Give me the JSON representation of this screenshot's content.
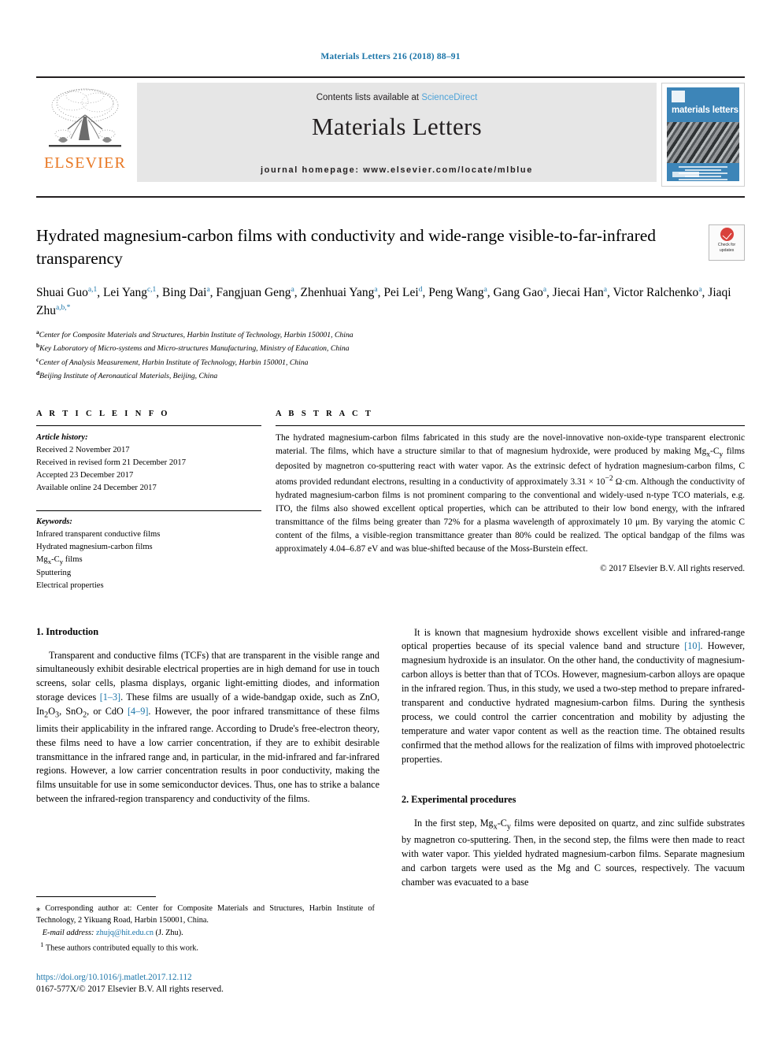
{
  "running_head": "Materials Letters 216 (2018) 88–91",
  "masthead": {
    "publisher": "ELSEVIER",
    "contents_prefix": "Contents lists available at ",
    "contents_link": "ScienceDirect",
    "journal_title": "Materials Letters",
    "homepage": "journal homepage: www.elsevier.com/locate/mlblue",
    "cover_label": "materials letters"
  },
  "title": "Hydrated magnesium-carbon films with conductivity and wide-range visible-to-far-infrared transparency",
  "crossmark": {
    "line1": "Check for",
    "line2": "updates"
  },
  "authors": [
    {
      "name": "Shuai Guo",
      "sup": "a,1",
      "sep": ", "
    },
    {
      "name": "Lei Yang",
      "sup": "c,1",
      "sep": ", "
    },
    {
      "name": "Bing Dai",
      "sup": "a",
      "sep": ", "
    },
    {
      "name": "Fangjuan Geng",
      "sup": "a",
      "sep": ", "
    },
    {
      "name": "Zhenhuai Yang",
      "sup": "a",
      "sep": ", "
    },
    {
      "name": "Pei Lei",
      "sup": "d",
      "sep": ", "
    },
    {
      "name": "Peng Wang",
      "sup": "a",
      "sep": ", "
    },
    {
      "name": "Gang Gao",
      "sup": "a",
      "sep": ", "
    },
    {
      "name": "Jiecai Han",
      "sup": "a",
      "sep": ", "
    },
    {
      "name": "Victor Ralchenko",
      "sup": "a",
      "sep": ", "
    },
    {
      "name": "Jiaqi Zhu",
      "sup": "a,b,*",
      "sep": ""
    }
  ],
  "affiliations": [
    {
      "mark": "a",
      "text": "Center for Composite Materials and Structures, Harbin Institute of Technology, Harbin 150001, China"
    },
    {
      "mark": "b",
      "text": "Key Laboratory of Micro-systems and Micro-structures Manufacturing, Ministry of Education, China"
    },
    {
      "mark": "c",
      "text": "Center of Analysis Measurement, Harbin Institute of Technology, Harbin 150001, China"
    },
    {
      "mark": "d",
      "text": "Beijing Institute of Aeronautical Materials, Beijing, China"
    }
  ],
  "article_info": {
    "heading": "A R T I C L E   I N F O",
    "history_label": "Article history:",
    "history": [
      "Received 2 November 2017",
      "Received in revised form 21 December 2017",
      "Accepted 23 December 2017",
      "Available online 24 December 2017"
    ],
    "keywords_label": "Keywords:",
    "keywords": [
      "Infrared transparent conductive films",
      "Hydrated magnesium-carbon films",
      "Mgx-Cy films",
      "Sputtering",
      "Electrical properties"
    ]
  },
  "abstract": {
    "heading": "A B S T R A C T",
    "p1_a": "The hydrated magnesium-carbon films fabricated in this study are the novel-innovative non-oxide-type transparent electronic material. The films, which have a structure similar to that of magnesium hydroxide, were produced by making Mg",
    "p1_b": "-C",
    "p1_c": " films deposited by magnetron co-sputtering react with water vapor. As the extrinsic defect of hydration magnesium-carbon films, C atoms provided redundant electrons, resulting in a conductivity of approximately 3.31 × 10",
    "p1_d": " Ω·cm. Although the conductivity of hydrated magnesium-carbon films is not prominent comparing to the conventional and widely-used n-type TCO materials, e.g. ITO, the films also showed excellent optical properties, which can be attributed to their low bond energy, with the infrared transmittance of the films being greater than 72% for a plasma wavelength of approximately 10 μm. By varying the atomic C content of the films, a visible-region transmittance greater than 80% could be realized. The optical bandgap of the films was approximately 4.04–6.87 eV and was blue-shifted because of the Moss-Burstein effect.",
    "sub_x": "x",
    "sub_y": "y",
    "sup_exp": "−2",
    "copyright": "© 2017 Elsevier B.V. All rights reserved."
  },
  "sections": {
    "intro_heading": "1. Introduction",
    "intro_p1_a": "Transparent and conductive films (TCFs) that are transparent in the visible range and simultaneously exhibit desirable electrical properties are in high demand for use in touch screens, solar cells, plasma displays, organic light-emitting diodes, and information storage devices ",
    "intro_ref1": "[1–3]",
    "intro_p1_b": ". These films are usually of a wide-bandgap oxide, such as ZnO, In",
    "intro_p1_c": "O",
    "intro_p1_d": ", SnO",
    "intro_p1_e": ", or CdO ",
    "intro_ref2": "[4–9]",
    "intro_p1_f": ". However, the poor infrared transmittance of these films limits their applicability in the infrared range. According to Drude's free-electron theory, these films need to have a low carrier concentration, if they are to exhibit desirable transmittance in the infrared range and, in particular, in the mid-infrared and far-infrared regions. However, a low carrier concentration results in poor conductivity, making the films unsuitable for use in some semiconductor devices. Thus, one has to strike a balance between the infrared-region transparency and conductivity of the films.",
    "right_p1_a": "It is known that magnesium hydroxide shows excellent visible and infrared-range optical properties because of its special valence band and structure ",
    "right_ref1": "[10]",
    "right_p1_b": ". However, magnesium hydroxide is an insulator. On the other hand, the conductivity of magnesium-carbon alloys is better than that of TCOs. However, magnesium-carbon alloys are opaque in the infrared region. Thus, in this study, we used a two-step method to prepare infrared-transparent and conductive hydrated magnesium-carbon films. During the synthesis process, we could control the carrier concentration and mobility by adjusting the temperature and water vapor content as well as the reaction time. The obtained results confirmed that the method allows for the realization of films with improved photoelectric properties.",
    "exp_heading": "2. Experimental procedures",
    "exp_p1_a": "In the first step, Mg",
    "exp_p1_b": "-C",
    "exp_p1_c": " films were deposited on quartz, and zinc sulfide substrates by magnetron co-sputtering. Then, in the second step, the films were then made to react with water vapor. This yielded hydrated magnesium-carbon films. Separate magnesium and carbon targets were used as the Mg and C sources, respectively. The vacuum chamber was evacuated to a base"
  },
  "footnotes": {
    "corresponding": "⁎ Corresponding author at: Center for Composite Materials and Structures, Harbin Institute of Technology, 2 Yikuang Road, Harbin 150001, China.",
    "email_label": "E-mail address:",
    "email": "zhujq@hit.edu.cn",
    "email_suffix": "(J. Zhu).",
    "equal_note": "These authors contributed equally to this work.",
    "equal_mark": "1",
    "doi": "https://doi.org/10.1016/j.matlet.2017.12.112",
    "issn_line": "0167-577X/© 2017 Elsevier B.V. All rights reserved."
  },
  "colors": {
    "link_blue": "#1a74a8",
    "sciencedirect_blue": "#4ea3d8",
    "elsevier_orange": "#e87722",
    "cover_blue": "#3d85b8",
    "masthead_grey": "#e6e6e6"
  }
}
